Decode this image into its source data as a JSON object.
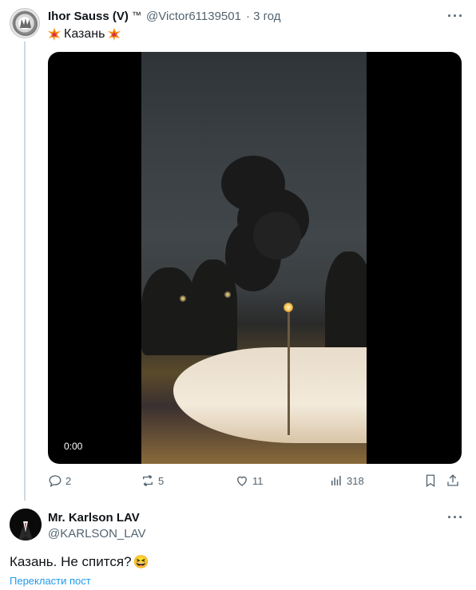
{
  "tweet": {
    "author_name": "Ihor Sauss (V)",
    "author_suffix": "™",
    "handle": "@Victor61139501",
    "time": "· 3 год",
    "text": "Казань",
    "video_time": "0:00",
    "more_label": "···",
    "stats": {
      "replies": "2",
      "retweets": "5",
      "likes": "11",
      "views": "318"
    }
  },
  "reply": {
    "author_name": "Mr. Karlson LAV",
    "handle": "@KARLSON_LAV",
    "text": "Казань. Не спится?",
    "emoji": "😆",
    "translate_label": "Перекласти пост",
    "more_label": "···"
  },
  "icons": {
    "reply": "comment-icon",
    "retweet": "retweet-icon",
    "like": "heart-icon",
    "views": "views-icon",
    "bookmark": "bookmark-icon",
    "share": "share-icon",
    "burst": "collision-emoji"
  },
  "colors": {
    "text_primary": "#0f1419",
    "text_secondary": "#536471",
    "link": "#1d9bf0",
    "thread_line": "#cfd9de"
  }
}
